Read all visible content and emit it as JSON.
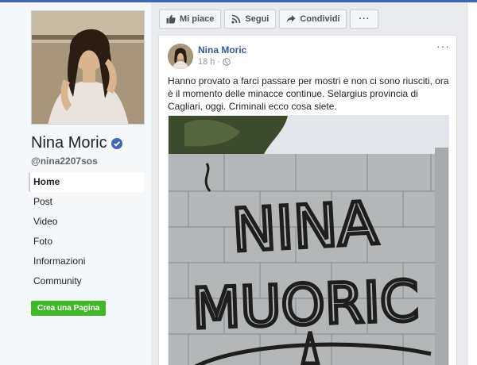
{
  "page": {
    "name": "Nina Moric",
    "username": "@nina2207sos"
  },
  "nav": {
    "items": [
      {
        "label": "Home"
      },
      {
        "label": "Post"
      },
      {
        "label": "Video"
      },
      {
        "label": "Foto"
      },
      {
        "label": "Informazioni"
      },
      {
        "label": "Community"
      }
    ]
  },
  "create_page_label": "Crea una Pagina",
  "actions": {
    "like": "Mi piace",
    "follow": "Segui",
    "share": "Condividi",
    "more": "···"
  },
  "post": {
    "author": "Nina Moric",
    "time": "18 h ·",
    "options": "···",
    "text": "Hanno provato a farci passare per mostri e non ci sono riusciti, ora è il momento delle minacce continue. Selargius provincia di Cagliari, oggi. Criminali ecco cosa siete.",
    "graffiti_lines": [
      "NINA",
      "MUORIC"
    ]
  },
  "colors": {
    "brand_blue": "#4267b2",
    "link_blue": "#365899",
    "green": "#42b72a",
    "page_bg": "#e9ebee"
  },
  "icons": {
    "verified": "verified-badge-icon",
    "like": "thumbs-up-icon",
    "follow": "rss-icon",
    "share": "share-arrow-icon",
    "privacy": "globe-icon"
  }
}
